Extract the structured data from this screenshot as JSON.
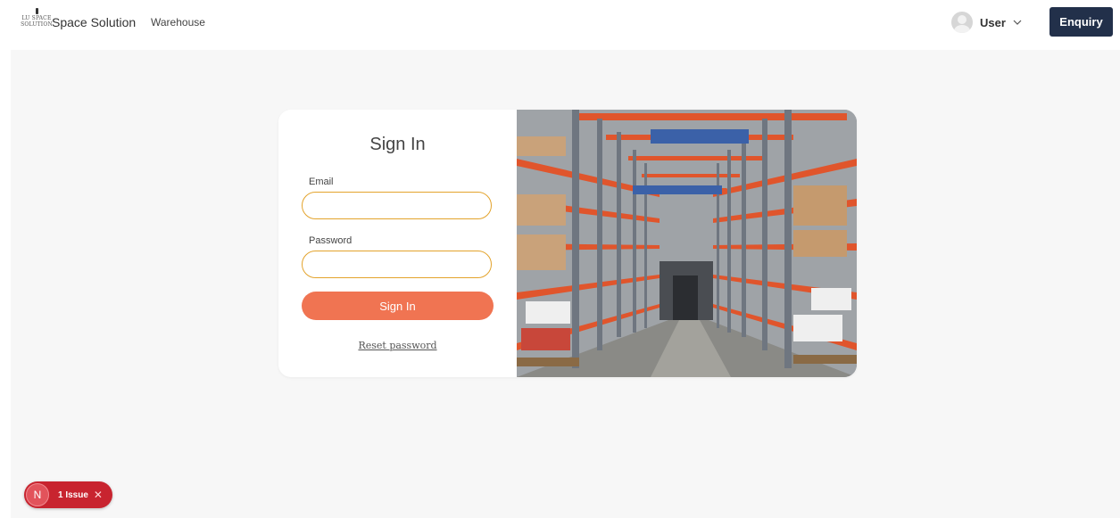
{
  "header": {
    "logo_line1": "LU SPACE",
    "logo_line2": "SOLUTION",
    "brand": "Space Solution",
    "nav_warehouse": "Warehouse",
    "user_label": "User",
    "enquiry_label": "Enquiry"
  },
  "signin": {
    "title": "Sign In",
    "email_label": "Email",
    "email_value": "",
    "password_label": "Password",
    "password_value": "",
    "submit_label": "Sign In",
    "reset_label": "Reset password"
  },
  "issue_badge": {
    "letter": "N",
    "text": "1 Issue",
    "close": "✕"
  },
  "colors": {
    "accent": "#f07452",
    "input_border": "#e3a32c",
    "enquiry_bg": "#22304a",
    "issue_bg": "#c8242f"
  }
}
